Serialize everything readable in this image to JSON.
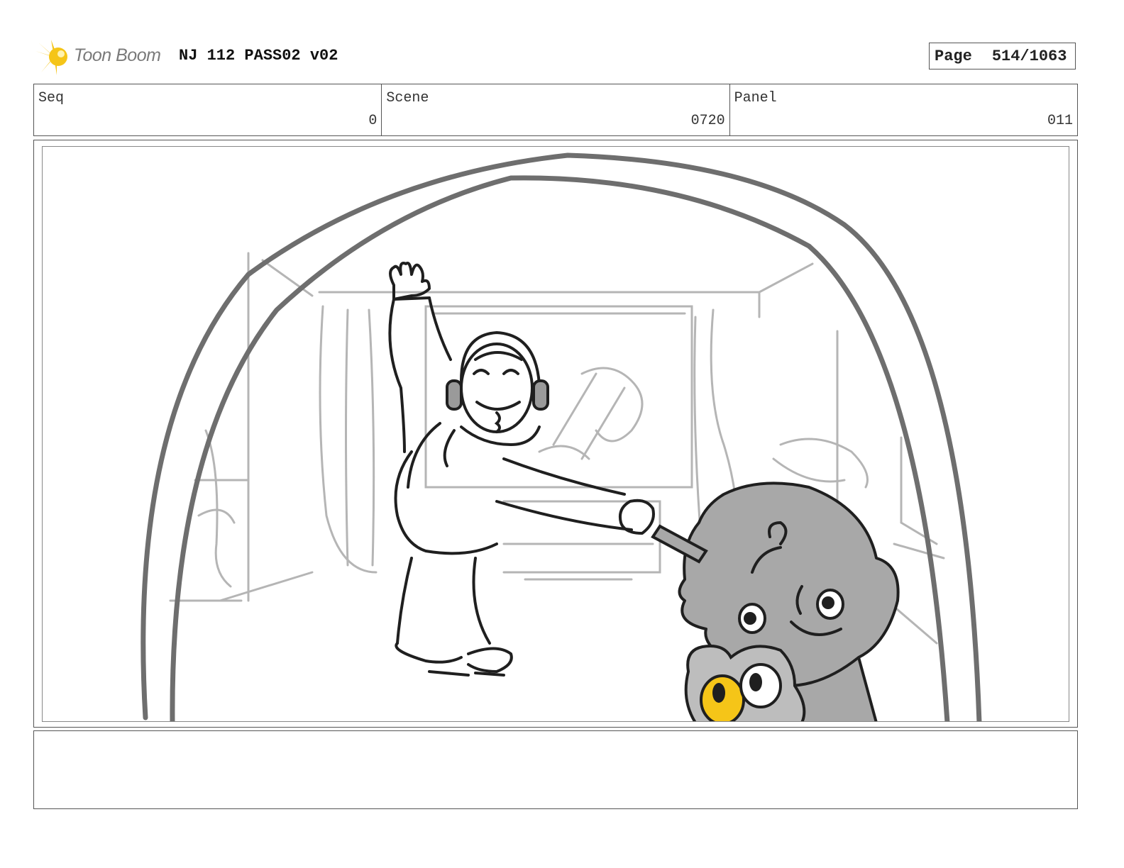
{
  "header": {
    "logo_text": "Toon Boom",
    "title": "NJ 112 PASS02 v02",
    "page_label": "Page",
    "page_value": "514/1063"
  },
  "info": {
    "seq_label": "Seq",
    "seq_value": "0",
    "scene_label": "Scene",
    "scene_value": "0720",
    "panel_label": "Panel",
    "panel_value": "011"
  },
  "notes": {
    "text": ""
  },
  "colors": {
    "accent_yellow": "#f5c518",
    "character_gray": "#a8a8a8",
    "line_dark": "#222222"
  }
}
